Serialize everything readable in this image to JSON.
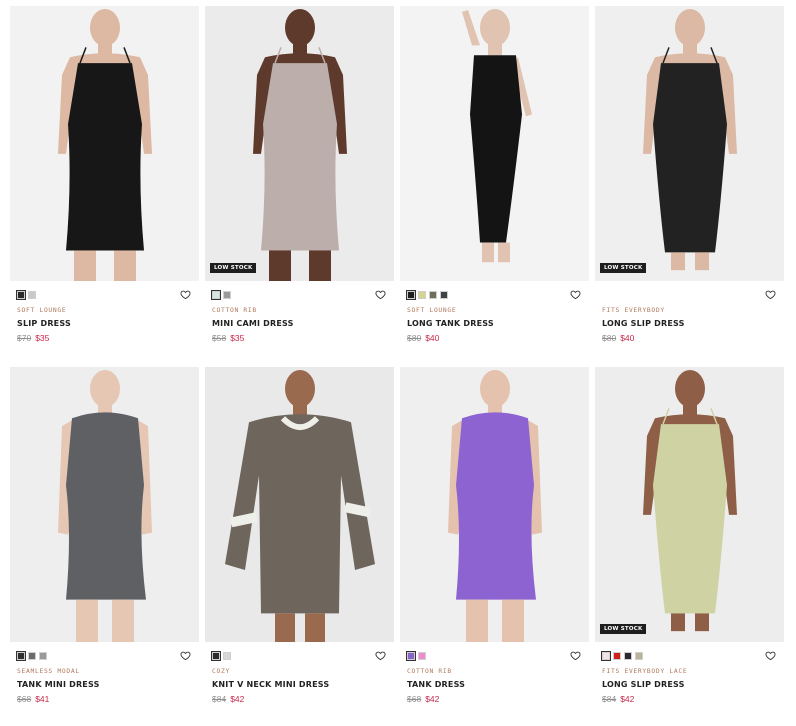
{
  "products": [
    {
      "collection": "SOFT LOUNGE",
      "name": "SLIP DRESS",
      "original_price": "$70",
      "sale_price": "$35",
      "badge": "",
      "swatches": [
        "#2b2b2b",
        "#c9c9c9"
      ],
      "dress_color": "#171717",
      "skin_color": "#ddb9a3",
      "bg_color": "#f2f2f2",
      "dress_style": "slip-mini"
    },
    {
      "collection": "COTTON RIB",
      "name": "MINI CAMI DRESS",
      "original_price": "$58",
      "sale_price": "$35",
      "badge": "LOW STOCK",
      "swatches": [
        "#d5e6e3",
        "#9e9a98"
      ],
      "dress_color": "#bcaeab",
      "skin_color": "#5e3a2c",
      "bg_color": "#ebebeb",
      "dress_style": "slip-mini"
    },
    {
      "collection": "SOFT LOUNGE",
      "name": "LONG TANK DRESS",
      "original_price": "$80",
      "sale_price": "$40",
      "badge": "",
      "swatches": [
        "#1e1e1e",
        "#d5d38d",
        "#6e6e5a",
        "#3f4242"
      ],
      "dress_color": "#141414",
      "skin_color": "#e0c3b0",
      "bg_color": "#f3f3f3",
      "dress_style": "tank-long"
    },
    {
      "collection": "FITS EVERYBODY",
      "name": "LONG SLIP DRESS",
      "original_price": "$80",
      "sale_price": "$40",
      "badge": "LOW STOCK",
      "swatches": [],
      "dress_color": "#232222",
      "skin_color": "#dcb9a4",
      "bg_color": "#efefef",
      "dress_style": "slip-long"
    },
    {
      "collection": "SEAMLESS MODAL",
      "name": "TANK MINI DRESS",
      "original_price": "$68",
      "sale_price": "$41",
      "badge": "",
      "swatches": [
        "#2f2f2f",
        "#6a6a6a",
        "#9a9a9a"
      ],
      "dress_color": "#5f6064",
      "skin_color": "#e6c7b3",
      "bg_color": "#eeeeee",
      "dress_style": "tank-mini"
    },
    {
      "collection": "COZY",
      "name": "KNIT V NECK MINI DRESS",
      "original_price": "$84",
      "sale_price": "$42",
      "badge": "",
      "swatches": [
        "#2b2b2b",
        "#d8d8d8"
      ],
      "dress_color": "#6e655c",
      "skin_color": "#9a6a4e",
      "bg_color": "#e9e9e9",
      "dress_style": "sweater"
    },
    {
      "collection": "COTTON RIB",
      "name": "TANK DRESS",
      "original_price": "$68",
      "sale_price": "$42",
      "badge": "",
      "swatches": [
        "#8a63c7",
        "#ef8ccf"
      ],
      "dress_color": "#8c63d1",
      "skin_color": "#e4c2ad",
      "bg_color": "#efefef",
      "dress_style": "tank-mini"
    },
    {
      "collection": "FITS EVERYBODY LACE",
      "name": "LONG SLIP DRESS",
      "original_price": "$84",
      "sale_price": "$42",
      "badge": "LOW STOCK",
      "swatches": [
        "#efe6ea",
        "#d01f1f",
        "#2a2a2a",
        "#b8b39a"
      ],
      "dress_color": "#cfd3a4",
      "skin_color": "#8e5f46",
      "bg_color": "#ededed",
      "dress_style": "slip-long"
    }
  ],
  "icons": {
    "wishlist": "heart-icon"
  }
}
